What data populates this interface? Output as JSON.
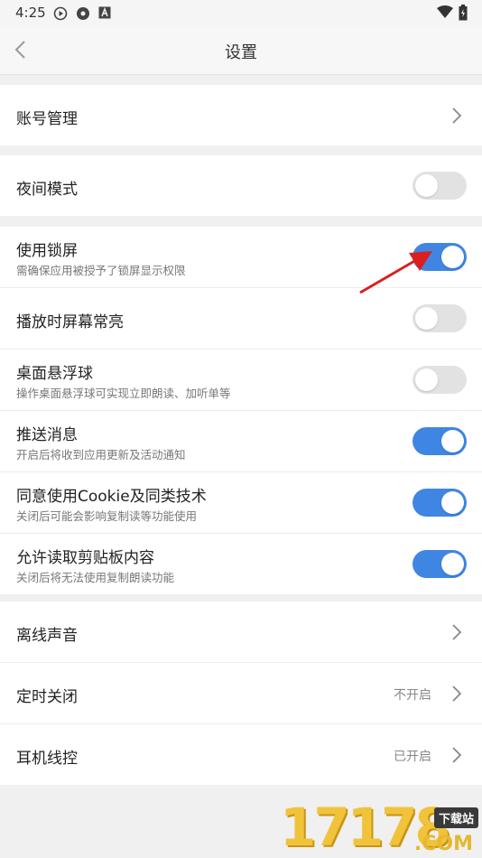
{
  "status_bar": {
    "time": "4:25"
  },
  "header": {
    "title": "设置"
  },
  "account": {
    "label": "账号管理"
  },
  "night": {
    "label": "夜间模式",
    "toggle_on": false
  },
  "toggles": [
    {
      "label": "使用锁屏",
      "sub": "需确保应用被授予了锁屏显示权限",
      "on": true
    },
    {
      "label": "播放时屏幕常亮",
      "sub": "",
      "on": false
    },
    {
      "label": "桌面悬浮球",
      "sub": "操作桌面悬浮球可实现立即朗读、加听单等",
      "on": false
    },
    {
      "label": "推送消息",
      "sub": "开启后将收到应用更新及活动通知",
      "on": true
    },
    {
      "label": "同意使用Cookie及同类技术",
      "sub": "关闭后可能会影响复制读等功能使用",
      "on": true
    },
    {
      "label": "允许读取剪贴板内容",
      "sub": "关闭后将无法使用复制朗读功能",
      "on": true
    }
  ],
  "links": [
    {
      "label": "离线声音",
      "value": ""
    },
    {
      "label": "定时关闭",
      "value": "不开启"
    },
    {
      "label": "耳机线控",
      "value": "已开启"
    }
  ],
  "watermark": {
    "number": "17178",
    "tag": "下载站",
    "com": ".COM"
  },
  "colors": {
    "accent": "#3f86e3",
    "annotation_arrow": "#d9201f"
  }
}
